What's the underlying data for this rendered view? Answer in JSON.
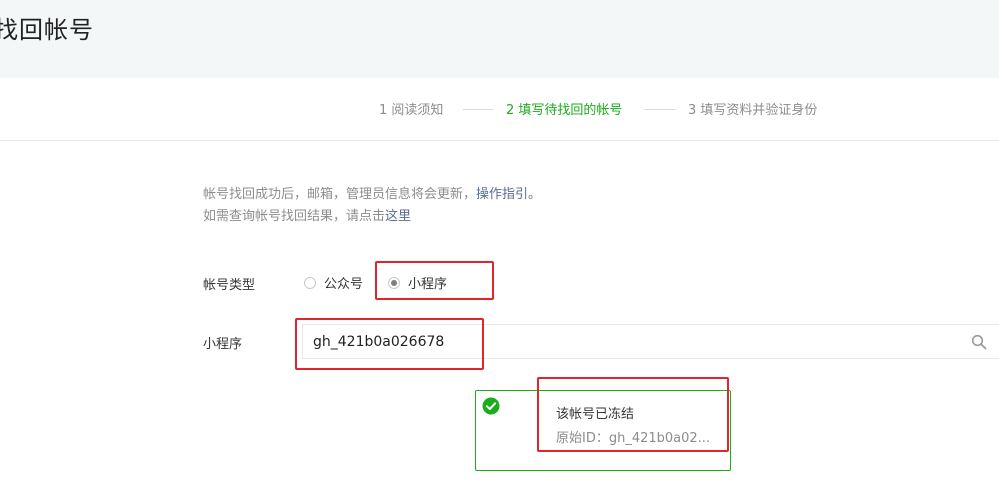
{
  "header": {
    "title": "找回帐号"
  },
  "steps": [
    {
      "label": "1 阅读须知"
    },
    {
      "label": "2 填写待找回的帐号"
    },
    {
      "label": "3 填写资料并验证身份"
    }
  ],
  "tips": {
    "line1_text": "帐号找回成功后，邮箱，管理员信息将会更新，",
    "line1_link": "操作指引。",
    "line2_text": "如需查询帐号找回结果，请点击",
    "line2_link": "这里"
  },
  "form": {
    "account_type_label": "帐号类型",
    "options": [
      {
        "label": "公众号",
        "selected": false
      },
      {
        "label": "小程序",
        "selected": true
      }
    ],
    "miniprogram_label": "小程序",
    "input_value": "gh_421b0a026678"
  },
  "result": {
    "status": "该帐号已冻结",
    "original_id": "原始ID：gh_421b0a02..."
  },
  "colors": {
    "accent": "#1aad19",
    "highlight": "#e0262c",
    "link": "#576b95"
  },
  "icons": {
    "search": "search-icon",
    "check": "check-circle-icon"
  }
}
